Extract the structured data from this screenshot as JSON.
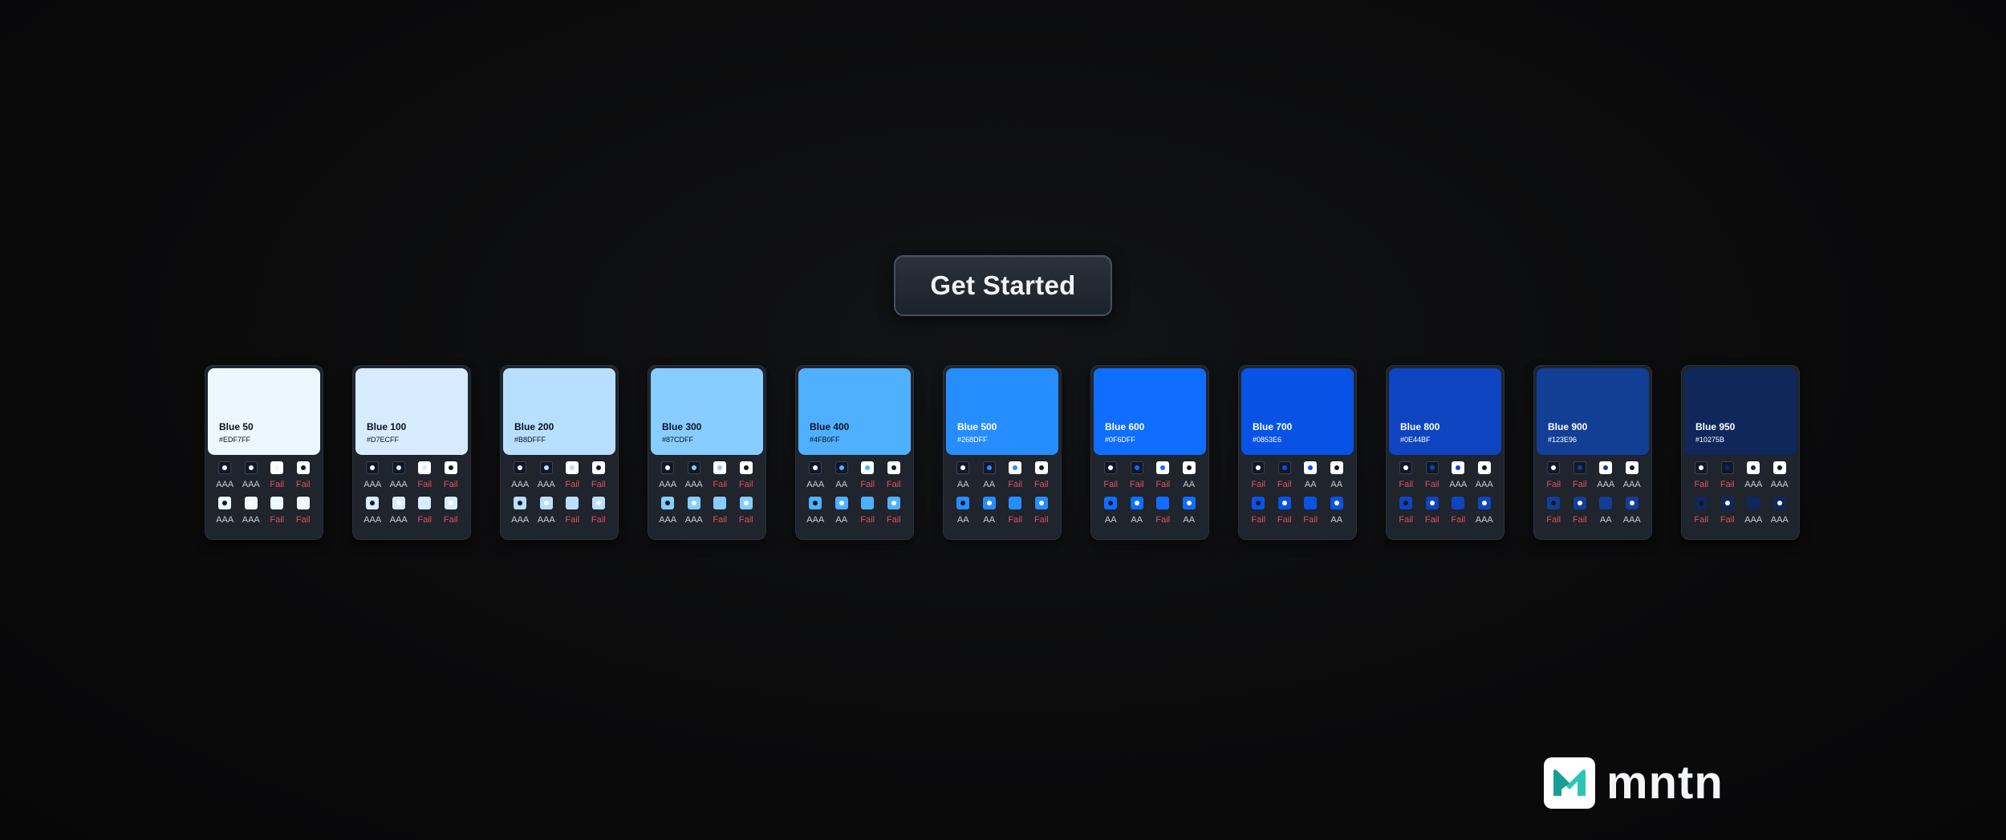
{
  "button": {
    "label": "Get Started"
  },
  "brand": {
    "name": "mntn",
    "colors": {
      "teal": "#2ec4b6",
      "teal_dark": "#1a9e93"
    }
  },
  "dark_ref": "#101828",
  "cards": [
    {
      "name": "Blue 50",
      "hex": "#EDF7FF",
      "labels": [
        "AAA",
        "AAA",
        "Fail",
        "Fail",
        "AAA",
        "AAA",
        "Fail",
        "Fail"
      ]
    },
    {
      "name": "Blue 100",
      "hex": "#D7ECFF",
      "labels": [
        "AAA",
        "AAA",
        "Fail",
        "Fail",
        "AAA",
        "AAA",
        "Fail",
        "Fail"
      ]
    },
    {
      "name": "Blue 200",
      "hex": "#B8DFFF",
      "labels": [
        "AAA",
        "AAA",
        "Fail",
        "Fail",
        "AAA",
        "AAA",
        "Fail",
        "Fail"
      ]
    },
    {
      "name": "Blue 300",
      "hex": "#87CDFF",
      "labels": [
        "AAA",
        "AAA",
        "Fail",
        "Fail",
        "AAA",
        "AAA",
        "Fail",
        "Fail"
      ]
    },
    {
      "name": "Blue 400",
      "hex": "#4FB0FF",
      "labels": [
        "AAA",
        "AA",
        "Fail",
        "Fail",
        "AAA",
        "AA",
        "Fail",
        "Fail"
      ]
    },
    {
      "name": "Blue 500",
      "hex": "#268DFF",
      "labels": [
        "AA",
        "AA",
        "Fail",
        "Fail",
        "AA",
        "AA",
        "Fail",
        "Fail"
      ]
    },
    {
      "name": "Blue 600",
      "hex": "#0F6DFF",
      "labels": [
        "Fail",
        "Fail",
        "Fail",
        "AA",
        "AA",
        "AA",
        "Fail",
        "AA"
      ]
    },
    {
      "name": "Blue 700",
      "hex": "#0853E6",
      "labels": [
        "Fail",
        "Fail",
        "AA",
        "AA",
        "Fail",
        "Fail",
        "Fail",
        "AA"
      ]
    },
    {
      "name": "Blue 800",
      "hex": "#0E44BF",
      "labels": [
        "Fail",
        "Fail",
        "AAA",
        "AAA",
        "Fail",
        "Fail",
        "Fail",
        "AAA"
      ]
    },
    {
      "name": "Blue 900",
      "hex": "#123E96",
      "labels": [
        "Fail",
        "Fail",
        "AAA",
        "AAA",
        "Fail",
        "Fail",
        "AA",
        "AAA"
      ]
    },
    {
      "name": "Blue 950",
      "hex": "#10275B",
      "labels": [
        "Fail",
        "Fail",
        "AAA",
        "AAA",
        "Fail",
        "Fail",
        "AAA",
        "AAA"
      ]
    }
  ]
}
